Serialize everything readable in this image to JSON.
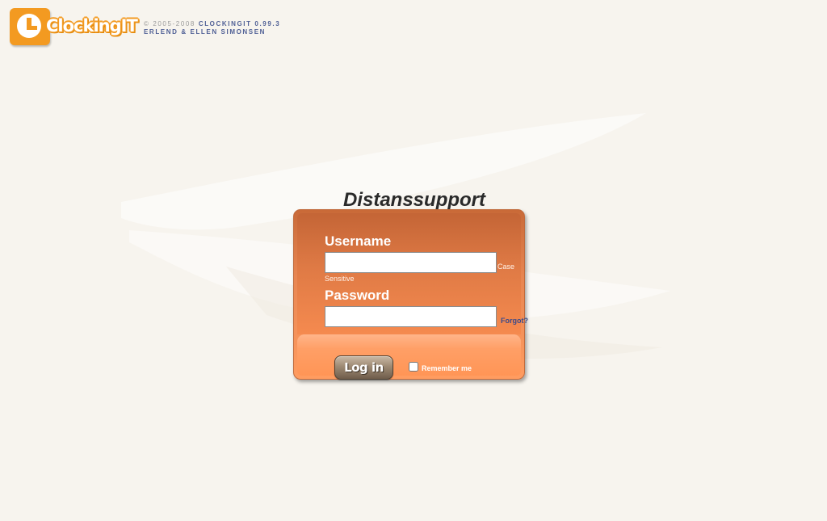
{
  "header": {
    "logo_text": "ClockingIT",
    "copyright": "© 2005-2008",
    "version": "CLOCKINGIT 0.99.3",
    "authors": "ERLEND & ELLEN SIMONSEN"
  },
  "login": {
    "title": "Distanssupport",
    "username_label": "Username",
    "username_value": "",
    "case_hint_1": "Case",
    "case_hint_2": "Sensitive",
    "password_label": "Password",
    "password_value": "",
    "forgot_link": "Forgot?",
    "login_button": "Log in",
    "remember_me_label": "Remember me",
    "remember_me_checked": false
  },
  "colors": {
    "background": "#f7f4ee",
    "brand_orange": "#f39a21",
    "login_box": "#e88652",
    "link_blue": "#3b4a8a"
  }
}
